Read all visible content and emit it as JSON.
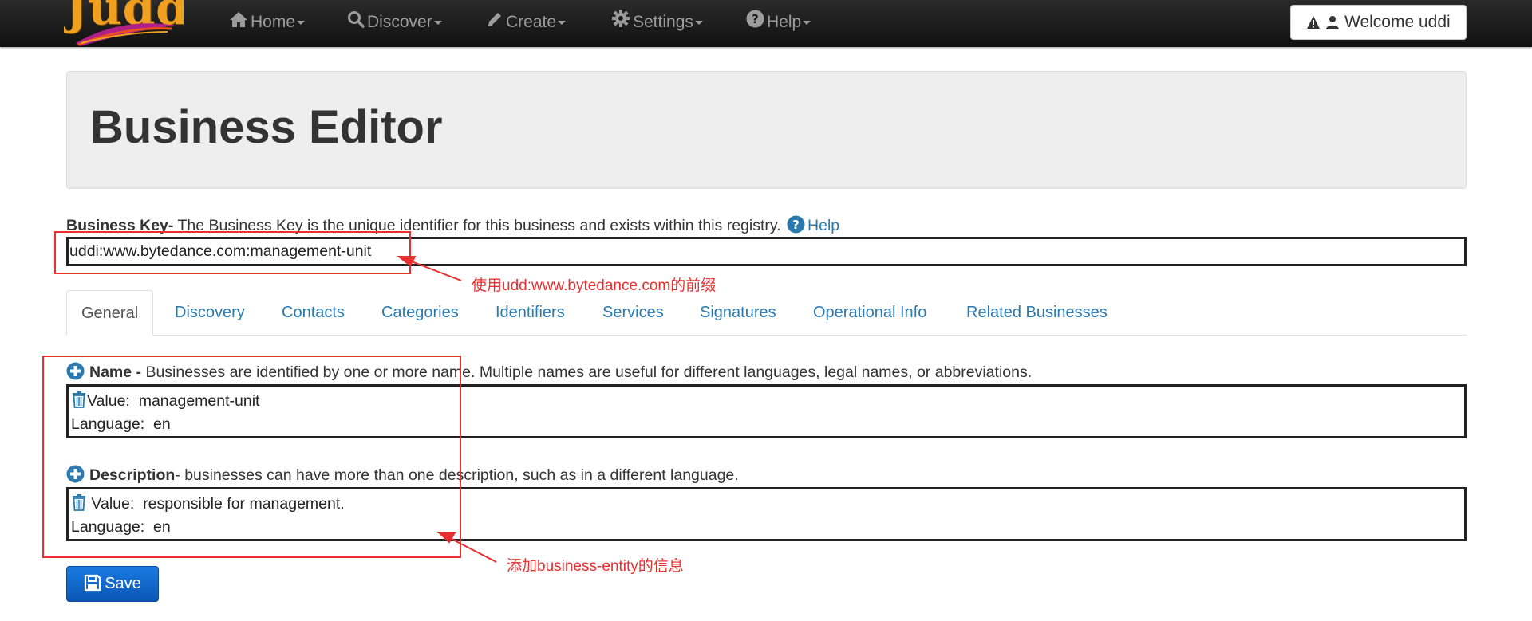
{
  "nav": {
    "logo_text": "Juddi",
    "items": [
      {
        "label": "Home",
        "icon": "home-icon"
      },
      {
        "label": "Discover",
        "icon": "search-icon"
      },
      {
        "label": "Create",
        "icon": "pencil-icon"
      },
      {
        "label": "Settings",
        "icon": "gear-icon"
      },
      {
        "label": "Help",
        "icon": "question-circle-icon"
      }
    ],
    "welcome": "Welcome uddi"
  },
  "page": {
    "title": "Business Editor"
  },
  "business_key": {
    "label": "Business Key-",
    "description": " The Business Key is the unique identifier for this business and exists within this registry.",
    "help_label": "Help",
    "value": "uddi:www.bytedance.com:management-unit"
  },
  "tabs": [
    "General",
    "Discovery",
    "Contacts",
    "Categories",
    "Identifiers",
    "Services",
    "Signatures",
    "Operational Info",
    "Related Businesses"
  ],
  "name_section": {
    "label": "Name -",
    "description": " Businesses are identified by one or more name. Multiple names are useful for different languages, legal names, or abbreviations.",
    "value_label": "Value:",
    "value": "management-unit",
    "language_label": "Language:",
    "language": "en"
  },
  "description_section": {
    "label": "Description",
    "description": "- businesses can have more than one description, such as in a different language.",
    "value_label": "Value:",
    "value": "responsible for management.",
    "language_label": "Language:",
    "language": "en"
  },
  "save_label": "Save",
  "annotations": {
    "prefix_note": "使用udd:www.bytedance.com的前缀",
    "entity_note": "添加business-entity的信息"
  },
  "colors": {
    "link": "#2a7ab0",
    "annotation": "#e83030",
    "navbar": "#1b1b1b",
    "save_button": "#0b5fc8"
  }
}
